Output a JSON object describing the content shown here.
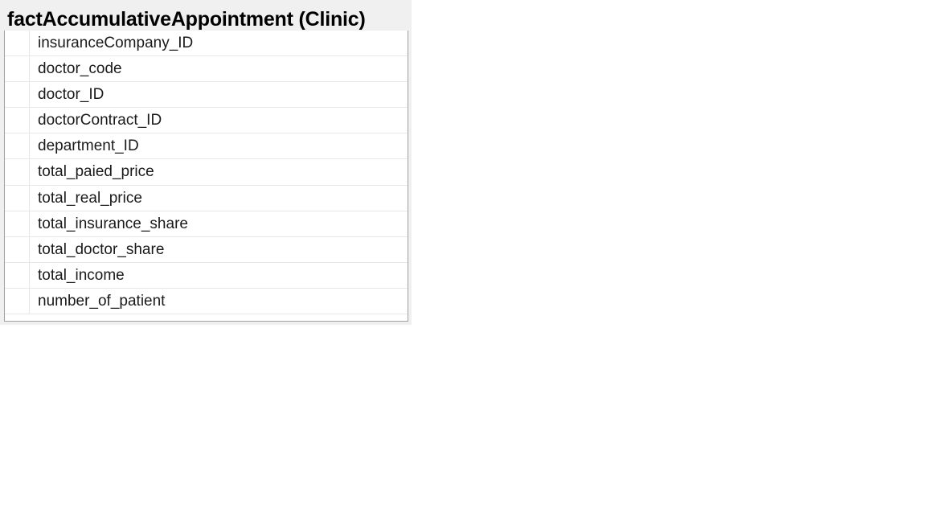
{
  "table": {
    "title": "factAccumulativeAppointment (Clinic)",
    "columns": [
      "insuranceCompany_ID",
      "doctor_code",
      "doctor_ID",
      "doctorContract_ID",
      "department_ID",
      "total_paied_price",
      "total_real_price",
      "total_insurance_share",
      "total_doctor_share",
      "total_income",
      "number_of_patient"
    ]
  }
}
